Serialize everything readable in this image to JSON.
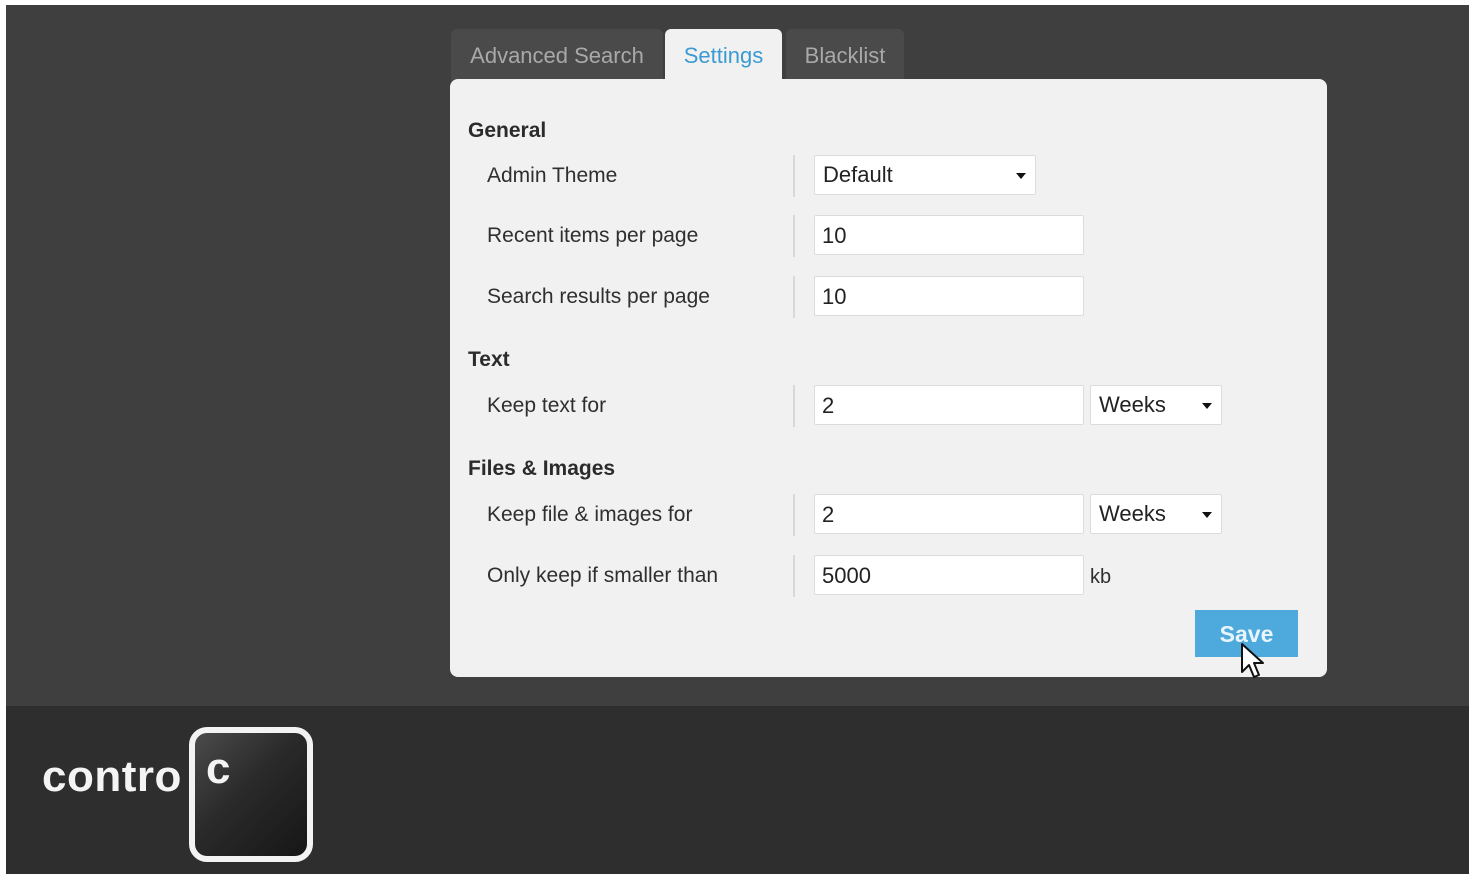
{
  "tabs": [
    {
      "label": "Advanced Search",
      "active": false
    },
    {
      "label": "Settings",
      "active": true
    },
    {
      "label": "Blacklist",
      "active": false
    }
  ],
  "sections": {
    "general": {
      "title": "General",
      "admin_theme": {
        "label": "Admin Theme",
        "value": "Default"
      },
      "recent_items": {
        "label": "Recent items per page",
        "value": "10"
      },
      "search_results": {
        "label": "Search results per page",
        "value": "10"
      }
    },
    "text": {
      "title": "Text",
      "keep_text": {
        "label": "Keep text for",
        "value": "2",
        "unit": "Weeks"
      }
    },
    "files": {
      "title": "Files & Images",
      "keep_files": {
        "label": "Keep file & images for",
        "value": "2",
        "unit": "Weeks"
      },
      "max_size": {
        "label": "Only keep if smaller than",
        "value": "5000",
        "unit": "kb"
      }
    }
  },
  "save_label": "Save",
  "branding": {
    "text": "contro",
    "key_letter": "c"
  },
  "colors": {
    "accent": "#4ea9dc",
    "active_tab_text": "#3a9ad2",
    "background": "#3f3f3f"
  }
}
